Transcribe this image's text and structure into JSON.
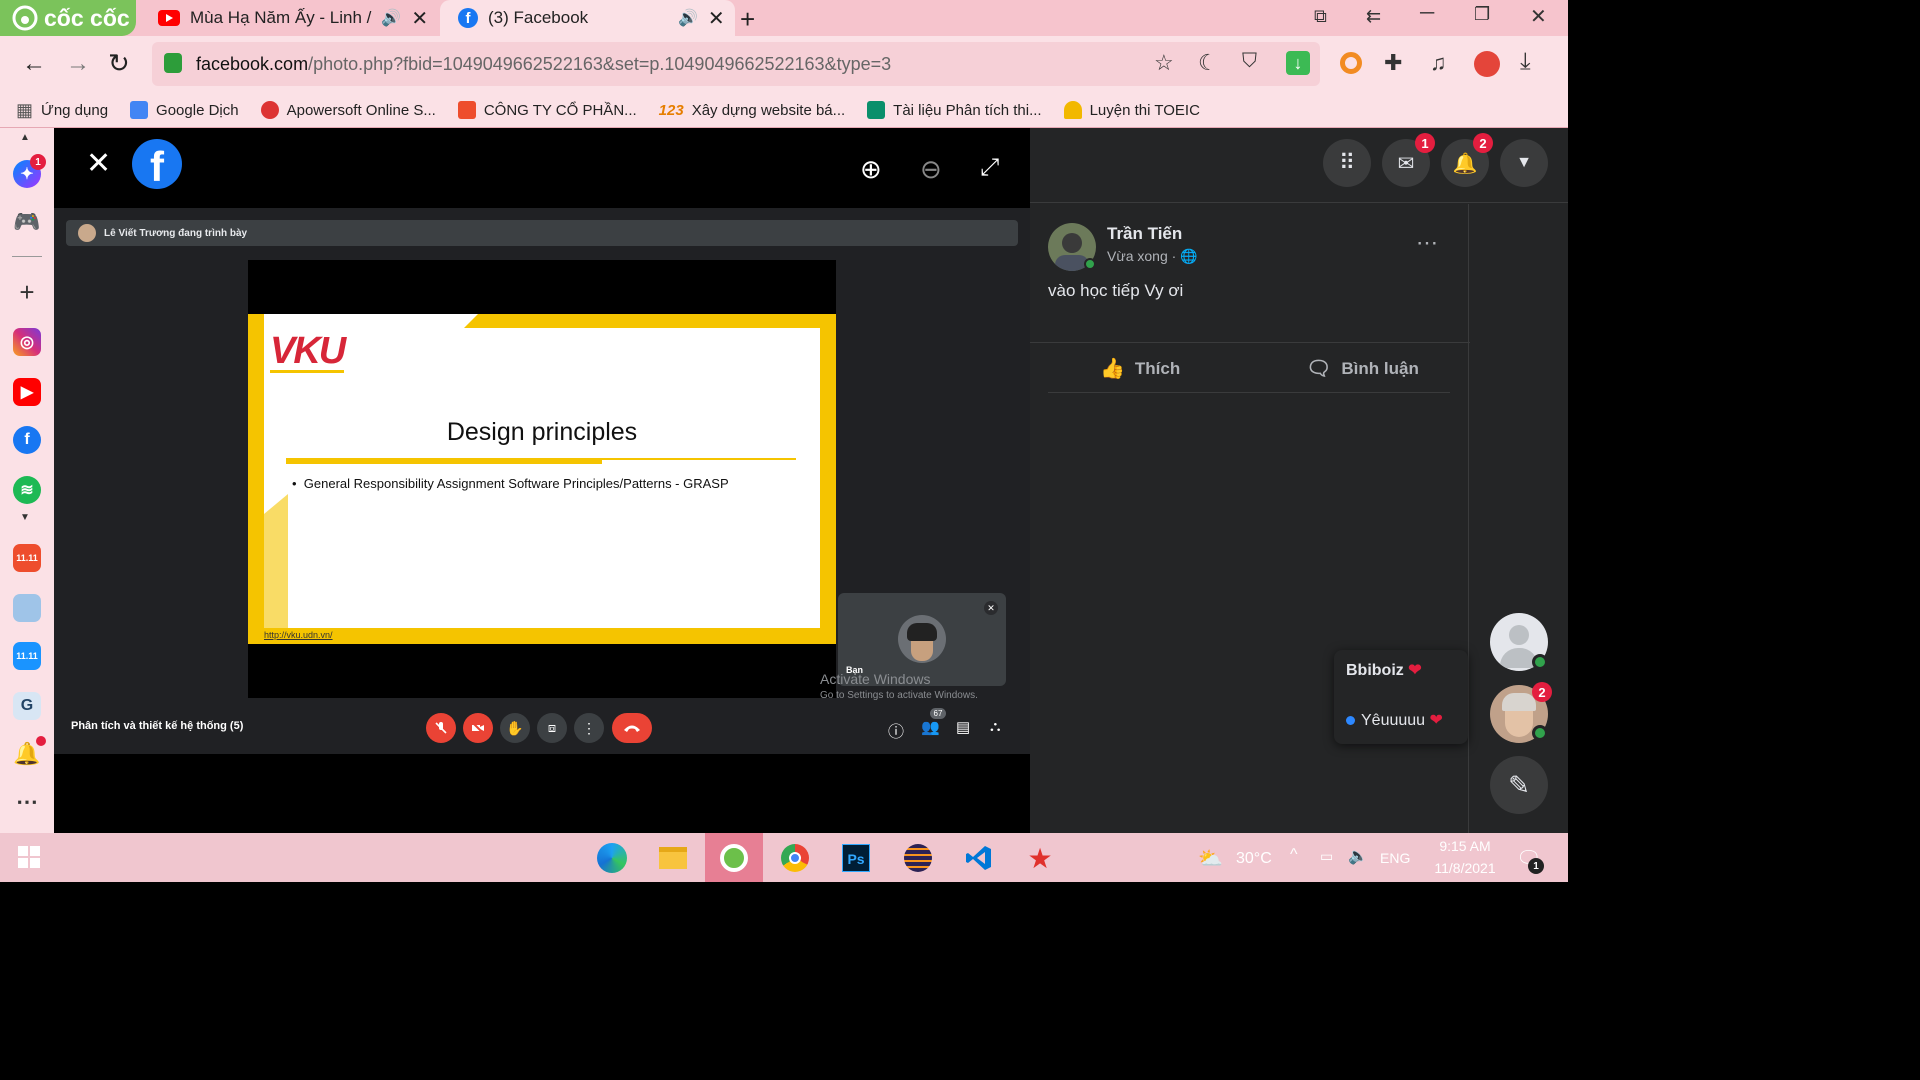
{
  "browser": {
    "logo": "cốc cốc",
    "tabs": [
      {
        "title": "Mùa Hạ Năm Ấy - Linh /",
        "active": false
      },
      {
        "title": "(3) Facebook",
        "active": true
      }
    ],
    "url_host": "facebook.com",
    "url_path": "/photo.php?fbid=1049049662522163&set=p.1049049662522163&type=3",
    "bookmarks": [
      "Ứng dụng",
      "Google Dịch",
      "Apowersoft Online S...",
      "CÔNG TY CỔ PHẦN...",
      "Xây dựng website bá...",
      "Tài liệu Phân tích thi...",
      "Luyện thi TOEIC"
    ],
    "sidebar_badge": "1"
  },
  "meet": {
    "presenter": "Lê Viết Trương đang trình bày",
    "slide": {
      "logo": "VKU",
      "title": "Design principles",
      "bullet": "General Responsibility Assignment Software Principles/Patterns - GRASP",
      "footer": "http://vku.udn.vn/"
    },
    "self_label": "Bạn",
    "watermark_title": "Activate Windows",
    "watermark_sub": "Go to Settings to activate Windows.",
    "meeting_name": "Phân tích và thiết kế hệ thống (5)",
    "participants": "67"
  },
  "facebook": {
    "messenger_badge": "1",
    "notif_badge": "2",
    "author": "Trần Tiến",
    "time": "Vừa xong",
    "caption": "vào học tiếp Vy ơi",
    "like_label": "Thích",
    "comment_label": "Bình luận",
    "chat_name": "Bbiboiz",
    "chat_msg": "Yêuuuuu",
    "chat_badge": "2"
  },
  "taskbar": {
    "weather": "30°C",
    "lang": "ENG",
    "time": "9:15 AM",
    "date": "11/8/2021",
    "notif": "1"
  }
}
